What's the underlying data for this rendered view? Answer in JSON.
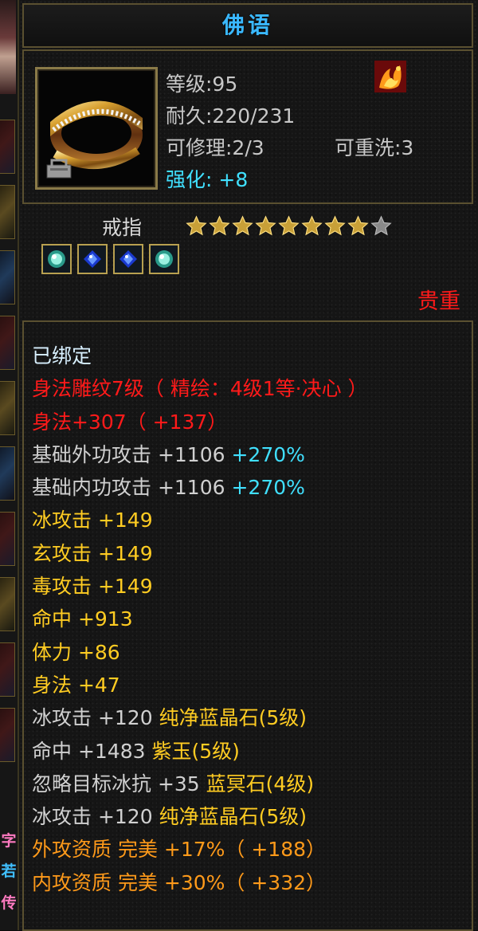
{
  "panel": {
    "title": "佛语"
  },
  "item": {
    "level": "等级:95",
    "durability": "耐久:220/231",
    "repairable": "可修理:2/3",
    "rewash": "可重洗:3",
    "enhance_label": "强化:",
    "enhance_value": "+8",
    "type": "戒指",
    "stars_total": 9,
    "stars_filled": 8,
    "rarity": "贵重",
    "gems": [
      "green-gem-icon",
      "blue-crystal-icon",
      "blue-crystal-icon",
      "green-gem-icon"
    ]
  },
  "left_strip": {
    "chars": [
      "字",
      "若",
      "传"
    ]
  },
  "attributes": [
    {
      "parts": [
        {
          "text": "已绑定",
          "color": "binding"
        }
      ]
    },
    {
      "parts": [
        {
          "text": "身法雕纹7级（ 精绘：4级1等·决心 ）",
          "color": "red"
        }
      ]
    },
    {
      "parts": [
        {
          "text": "身法+307（ +137）",
          "color": "red"
        }
      ]
    },
    {
      "parts": [
        {
          "text": "基础外功攻击 +1106 ",
          "color": "white"
        },
        {
          "text": "+270%",
          "color": "cyan"
        }
      ]
    },
    {
      "parts": [
        {
          "text": "基础内功攻击 +1106 ",
          "color": "white"
        },
        {
          "text": "+270%",
          "color": "cyan"
        }
      ]
    },
    {
      "parts": [
        {
          "text": "冰攻击 +149",
          "color": "yellow"
        }
      ]
    },
    {
      "parts": [
        {
          "text": "玄攻击 +149",
          "color": "yellow"
        }
      ]
    },
    {
      "parts": [
        {
          "text": "毒攻击 +149",
          "color": "yellow"
        }
      ]
    },
    {
      "parts": [
        {
          "text": "命中 +913",
          "color": "yellow"
        }
      ]
    },
    {
      "parts": [
        {
          "text": "体力 +86",
          "color": "yellow"
        }
      ]
    },
    {
      "parts": [
        {
          "text": "身法 +47",
          "color": "yellow"
        }
      ]
    },
    {
      "parts": [
        {
          "text": "冰攻击 +120 ",
          "color": "white"
        },
        {
          "text": "纯净蓝晶石(5级)",
          "color": "yellow"
        }
      ]
    },
    {
      "parts": [
        {
          "text": "命中 +1483 ",
          "color": "white"
        },
        {
          "text": "紫玉(5级)",
          "color": "yellow"
        }
      ]
    },
    {
      "parts": [
        {
          "text": "忽略目标冰抗 +35 ",
          "color": "white"
        },
        {
          "text": "蓝冥石(4级)",
          "color": "yellow"
        }
      ]
    },
    {
      "parts": [
        {
          "text": "冰攻击 +120 ",
          "color": "white"
        },
        {
          "text": "纯净蓝晶石(5级)",
          "color": "yellow"
        }
      ]
    },
    {
      "parts": [
        {
          "text": "外攻资质 完美 +17%（ +188）",
          "color": "orange"
        }
      ]
    },
    {
      "parts": [
        {
          "text": "内攻资质 完美 +30%（ +332）",
          "color": "orange"
        }
      ]
    }
  ],
  "colors": {
    "title": "#3ab8ff",
    "white": "#d0d0d0",
    "cyan": "#40e0ff",
    "red": "#ff1a1a",
    "yellow": "#ffcc22",
    "orange": "#ff9a1a",
    "binding": "#d8f0ff",
    "frame": "#5a5030"
  }
}
